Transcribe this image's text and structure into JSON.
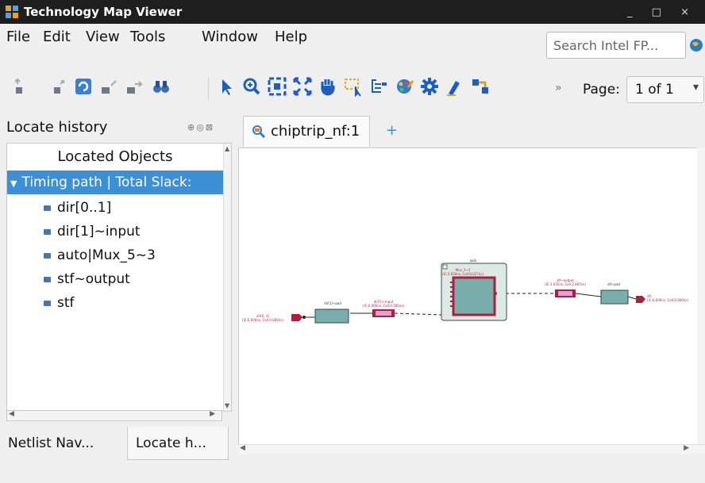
{
  "window": {
    "title": "Technology Map Viewer",
    "buttons": "_ □ ×"
  },
  "menu": {
    "items": [
      {
        "label": "File"
      },
      {
        "label": "Edit"
      },
      {
        "label": "View"
      },
      {
        "label": "Tools"
      },
      {
        "label": "Window"
      },
      {
        "label": "Help"
      }
    ],
    "search_placeholder": "Search Intel FP..."
  },
  "toolbar": {
    "overflow": "»",
    "page_label": "Page:",
    "page_value": "1 of 1",
    "page_arrow": "▾"
  },
  "left_panel": {
    "title": "Locate history",
    "header_icons": "⊕◎⊠",
    "column_header": "Located Objects",
    "selected_node": "Timing path | Total Slack:",
    "items": [
      "dir[0..1]",
      "dir[1]~input",
      "auto|Mux_5~3",
      "stf~output",
      "stf"
    ],
    "tabs": [
      "Netlist Nav...",
      "Locate h..."
    ]
  },
  "editor": {
    "tab_label": "chiptrip_nf:1",
    "new_tab": "+"
  },
  "schematic": {
    "auto_label": "auto",
    "mux_name": "Mux_5~3",
    "mux_timing": "(IC:3.659ns, Cell:0.027ns)",
    "dir_port": "dir[0..1]",
    "dir_port_timing": "(IC:0.000ns, Cell:0.000ns)",
    "dir_pad": "dir[1]~pad",
    "dir_input": "dir[1]~input",
    "dir_input_timing": "(IC:0.000ns, Cell:0.785ns)",
    "stf_output": "stf~output",
    "stf_output_timing": "(IC:1.035ns, Cell:2.467ns)",
    "stf_pad": "stf~pad",
    "stf_port": "stf",
    "stf_port_timing": "(IC:0.000ns, Cell:0.000ns)"
  },
  "colors": {
    "selection": "#3d8fd6",
    "block_fill": "#79aeac",
    "port_red": "#b01e3c",
    "buffer_pink": "#e0a0d8"
  }
}
